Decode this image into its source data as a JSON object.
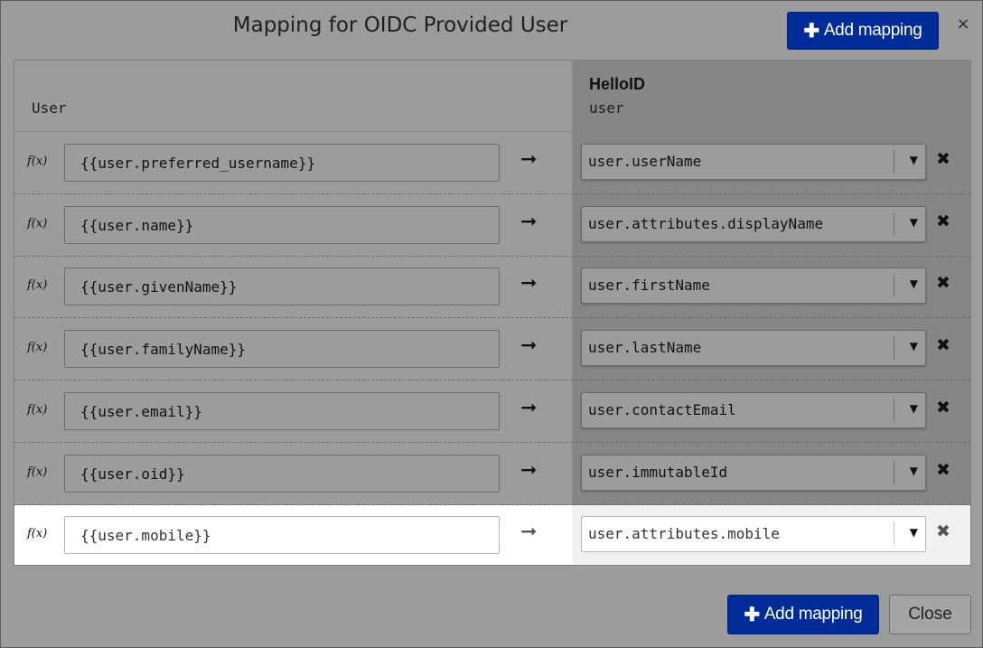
{
  "dialog": {
    "title": "Mapping for OIDC Provided User",
    "add_mapping_label": "Add mapping",
    "close_x": "×",
    "close_label": "Close"
  },
  "columns": {
    "source_header": "User",
    "target_title": "HelloID",
    "target_sub": "user"
  },
  "icons": {
    "plus": "plus-icon",
    "function": "function-icon",
    "arrow": "arrow-right-icon",
    "dropdown": "chevron-down-icon",
    "remove": "remove-icon"
  },
  "glyphs": {
    "plus": "✚",
    "fx": "f(x)",
    "arrow": "➞",
    "chevron": "▼",
    "remove": "✖"
  },
  "colors": {
    "primary": "#002c9a",
    "overlay": "#9c9c9c",
    "active_row": "#ffffff"
  },
  "mappings": [
    {
      "source": "{{user.preferred_username}}",
      "target": "user.userName"
    },
    {
      "source": "{{user.name}}",
      "target": "user.attributes.displayName"
    },
    {
      "source": "{{user.givenName}}",
      "target": "user.firstName"
    },
    {
      "source": "{{user.familyName}}",
      "target": "user.lastName"
    },
    {
      "source": "{{user.email}}",
      "target": "user.contactEmail"
    },
    {
      "source": "{{user.oid}}",
      "target": "user.immutableId"
    },
    {
      "source": "{{user.mobile}}",
      "target": "user.attributes.mobile"
    }
  ]
}
